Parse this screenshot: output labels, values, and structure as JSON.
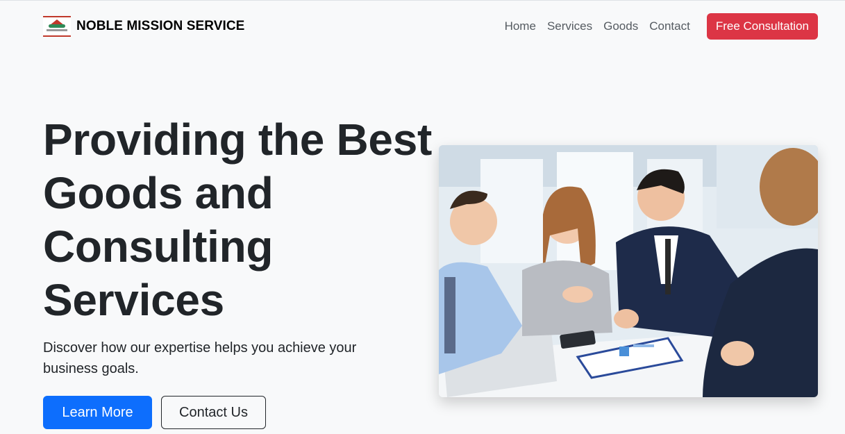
{
  "brand": {
    "name": "NOBLE MISSION SERVICE",
    "logo_icon": "company-logo-icon"
  },
  "nav": {
    "items": [
      "Home",
      "Services",
      "Goods",
      "Contact"
    ],
    "cta_label": "Free Consultation"
  },
  "hero": {
    "title": "Providing the Best Goods and Consulting Services",
    "subtitle": "Discover how our expertise helps you achieve your business goals.",
    "primary_button": "Learn More",
    "secondary_button": "Contact Us"
  },
  "colors": {
    "background": "#f8f9fa",
    "primary": "#0d6efd",
    "danger": "#dc3545",
    "text": "#212529",
    "nav_text": "#555b61"
  }
}
